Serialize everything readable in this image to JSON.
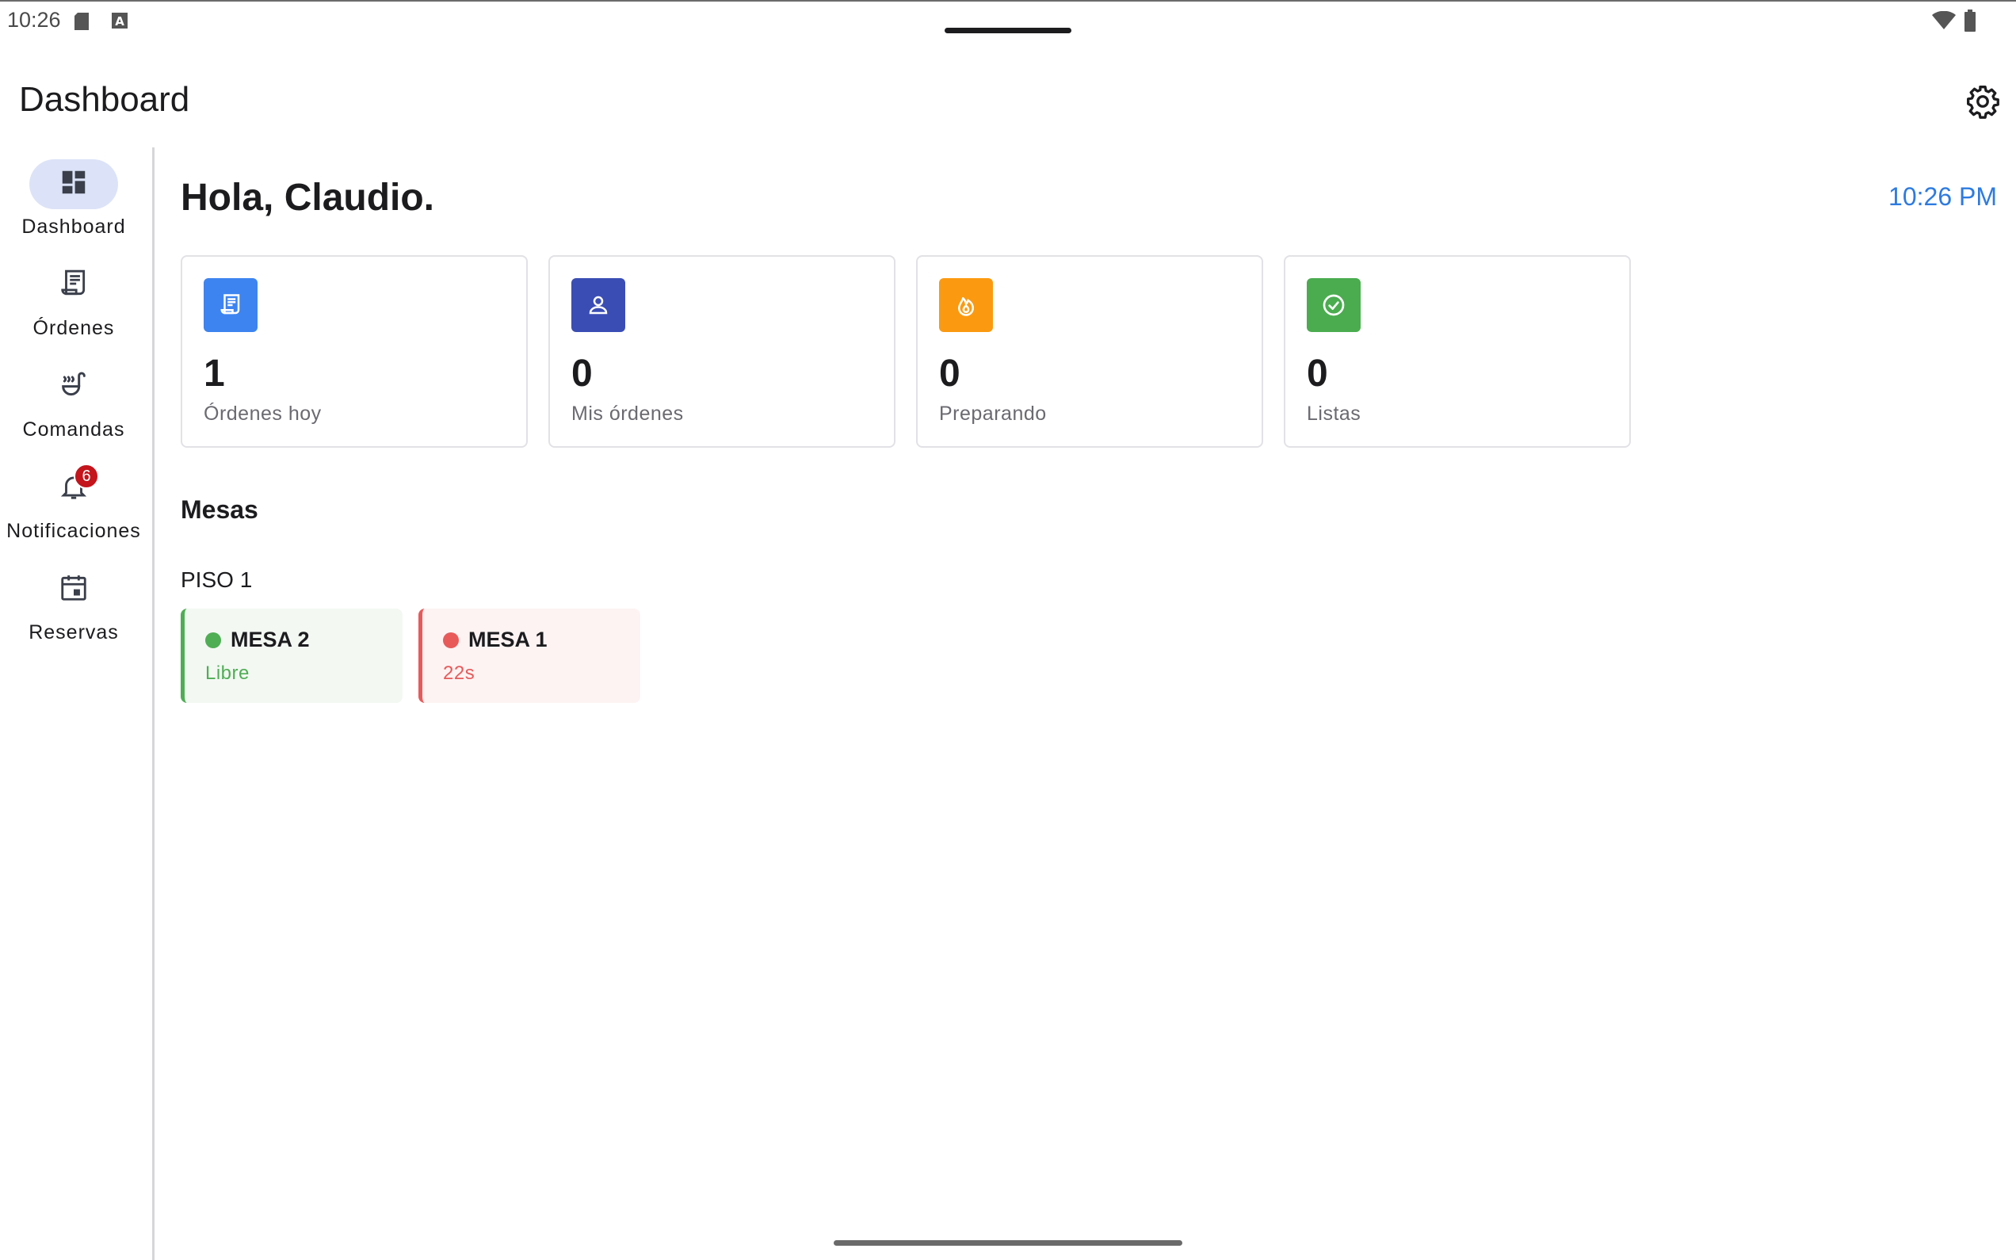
{
  "status_bar": {
    "time": "10:26",
    "icons": [
      "sd-card-icon",
      "keyboard-a-icon",
      "wifi-icon",
      "battery-icon"
    ]
  },
  "app_bar": {
    "title": "Dashboard",
    "settings_icon": "gear-icon"
  },
  "nav_rail": {
    "items": [
      {
        "label": "Dashboard",
        "icon": "dashboard-icon",
        "active": true
      },
      {
        "label": "Órdenes",
        "icon": "receipt-icon",
        "active": false
      },
      {
        "label": "Comandas",
        "icon": "soup-kitchen-icon",
        "active": false
      },
      {
        "label": "Notificaciones",
        "icon": "bell-icon",
        "active": false,
        "badge": "6"
      },
      {
        "label": "Reservas",
        "icon": "calendar-icon",
        "active": false
      }
    ]
  },
  "main": {
    "greeting": "Hola, Claudio.",
    "clock": "10:26 PM",
    "stats": [
      {
        "value": "1",
        "label": "Órdenes hoy",
        "icon": "receipt-icon",
        "color": "#3d84f0"
      },
      {
        "value": "0",
        "label": "Mis órdenes",
        "icon": "person-icon",
        "color": "#3a4db5"
      },
      {
        "value": "0",
        "label": "Preparando",
        "icon": "fire-icon",
        "color": "#fb9a10"
      },
      {
        "value": "0",
        "label": "Listas",
        "icon": "check-circle-icon",
        "color": "#4aac4f"
      }
    ],
    "tables_section": {
      "title": "Mesas",
      "floors": [
        {
          "name": "PISO 1",
          "tables": [
            {
              "name": "MESA 2",
              "status": "Libre",
              "color": "#4fae54"
            },
            {
              "name": "MESA 1",
              "status": "22s",
              "color": "#e85a5a"
            }
          ]
        }
      ]
    }
  },
  "colors": {
    "accent": "#2d7be0",
    "rail_active_bg": "#dce3f8",
    "badge": "#c4141c"
  }
}
